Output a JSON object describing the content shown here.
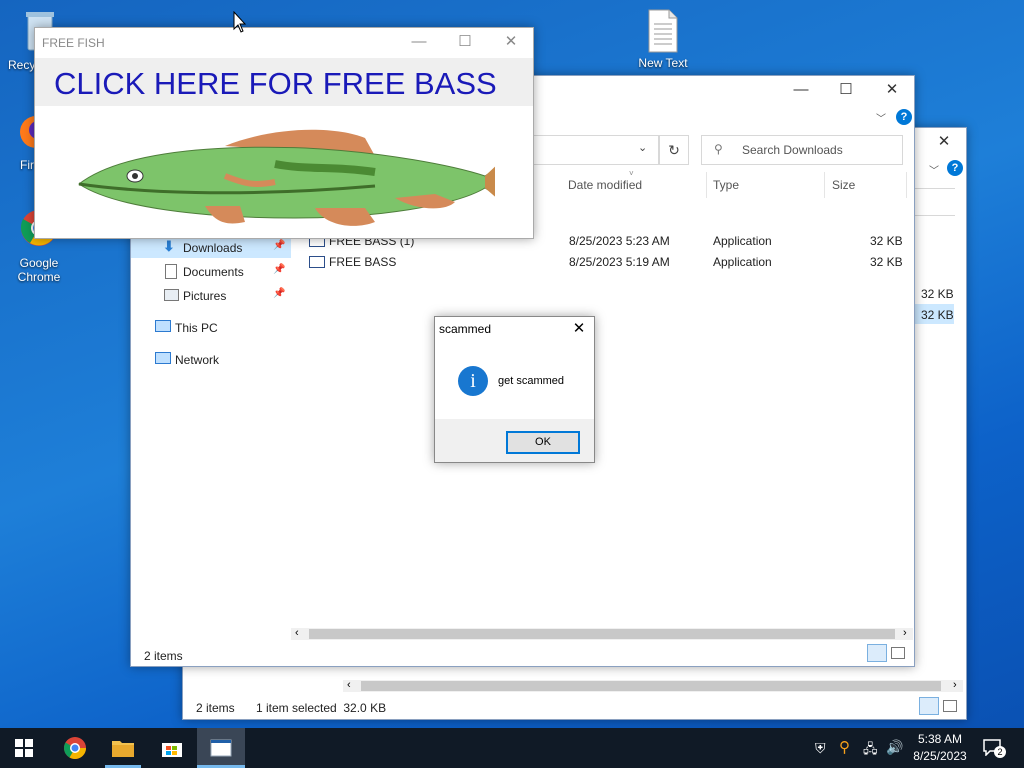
{
  "desktop": {
    "icons": [
      {
        "label": "Recy"
      },
      {
        "label": "Fir"
      },
      {
        "label": "Google\nChrome"
      },
      {
        "label": "New Text"
      }
    ]
  },
  "explorer_back": {
    "status_items": "2 items",
    "status_selected": "1 item selected  32.0 KB",
    "size_1": "32 KB",
    "size_2": "32 KB"
  },
  "explorer_front": {
    "search_placeholder": "Search Downloads",
    "columns": {
      "date": "Date modified",
      "type": "Type",
      "size": "Size"
    },
    "files": [
      {
        "name": "FREE BASS (1)",
        "date": "8/25/2023 5:23 AM",
        "type": "Application",
        "size": "32 KB"
      },
      {
        "name": "FREE BASS",
        "date": "8/25/2023 5:19 AM",
        "type": "Application",
        "size": "32 KB"
      }
    ],
    "nav": {
      "downloads": "Downloads",
      "documents": "Documents",
      "pictures": "Pictures",
      "thispc": "This PC",
      "network": "Network"
    },
    "status_items": "2 items"
  },
  "free_fish": {
    "title": "FREE FISH",
    "banner": "CLICK HERE FOR FREE BASS"
  },
  "dialog": {
    "title": "scammed",
    "message": "get scammed",
    "ok": "OK"
  },
  "taskbar": {
    "time": "5:38 AM",
    "date": "8/25/2023",
    "notif_count": "2"
  },
  "colors": {
    "accent": "#0078d7",
    "banner_text": "#1a1ab8"
  }
}
